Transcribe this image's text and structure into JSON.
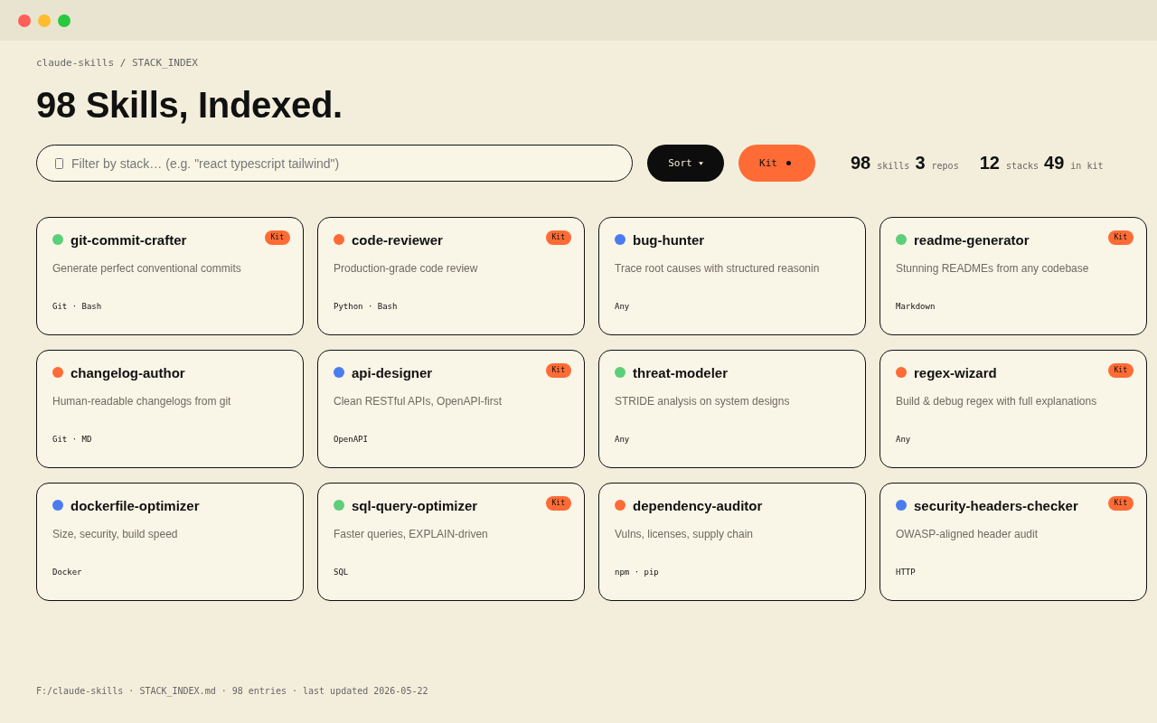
{
  "breadcrumb": "claude-skills / STACK_INDEX",
  "title": "98 Skills, Indexed.",
  "search": {
    "placeholder": "Filter by stack… (e.g. \"react typescript tailwind\")"
  },
  "sort_button": {
    "label": "Sort"
  },
  "kit_button": {
    "label": "Kit"
  },
  "stat_groups": [
    [
      "**98** skills",
      "**3** repos"
    ],
    [
      "**12** stacks",
      "**49** in kit"
    ]
  ],
  "cards": [
    {
      "name": "git-commit-crafter",
      "color": "#5ccf78",
      "badge": "Kit",
      "description": "Generate perfect conventional commits",
      "stack": "Git · Bash"
    },
    {
      "name": "code-reviewer",
      "color": "#ff6b35",
      "badge": "Kit",
      "description": "Production-grade code review",
      "stack": "Python · Bash"
    },
    {
      "name": "bug-hunter",
      "color": "#4a7cf0",
      "description": "Trace root causes with structured reasonin",
      "stack": "Any"
    },
    {
      "name": "readme-generator",
      "color": "#5ccf78",
      "badge": "Kit",
      "description": "Stunning READMEs from any codebase",
      "stack": "Markdown"
    },
    {
      "name": "changelog-author",
      "color": "#ff6b35",
      "description": "Human-readable changelogs from git",
      "stack": "Git · MD"
    },
    {
      "name": "api-designer",
      "color": "#4a7cf0",
      "badge": "Kit",
      "description": "Clean RESTful APIs, OpenAPI-first",
      "stack": "OpenAPI"
    },
    {
      "name": "threat-modeler",
      "color": "#5ccf78",
      "description": "STRIDE analysis on system designs",
      "stack": "Any"
    },
    {
      "name": "regex-wizard",
      "color": "#ff6b35",
      "badge": "Kit",
      "description": "Build & debug regex with full explanations",
      "stack": "Any"
    },
    {
      "name": "dockerfile-optimizer",
      "color": "#4a7cf0",
      "description": "Size, security, build speed",
      "stack": "Docker"
    },
    {
      "name": "sql-query-optimizer",
      "color": "#5ccf78",
      "badge": "Kit",
      "description": "Faster queries, EXPLAIN-driven",
      "stack": "SQL"
    },
    {
      "name": "dependency-auditor",
      "color": "#ff6b35",
      "description": "Vulns, licenses, supply chain",
      "stack": "npm · pip"
    },
    {
      "name": "security-headers-checker",
      "color": "#4a7cf0",
      "badge": "Kit",
      "description": "OWASP-aligned header audit",
      "stack": "HTTP"
    }
  ],
  "footer": "F:/claude-skills · STACK_INDEX.md · 98 entries · last updated 2026-05-22"
}
